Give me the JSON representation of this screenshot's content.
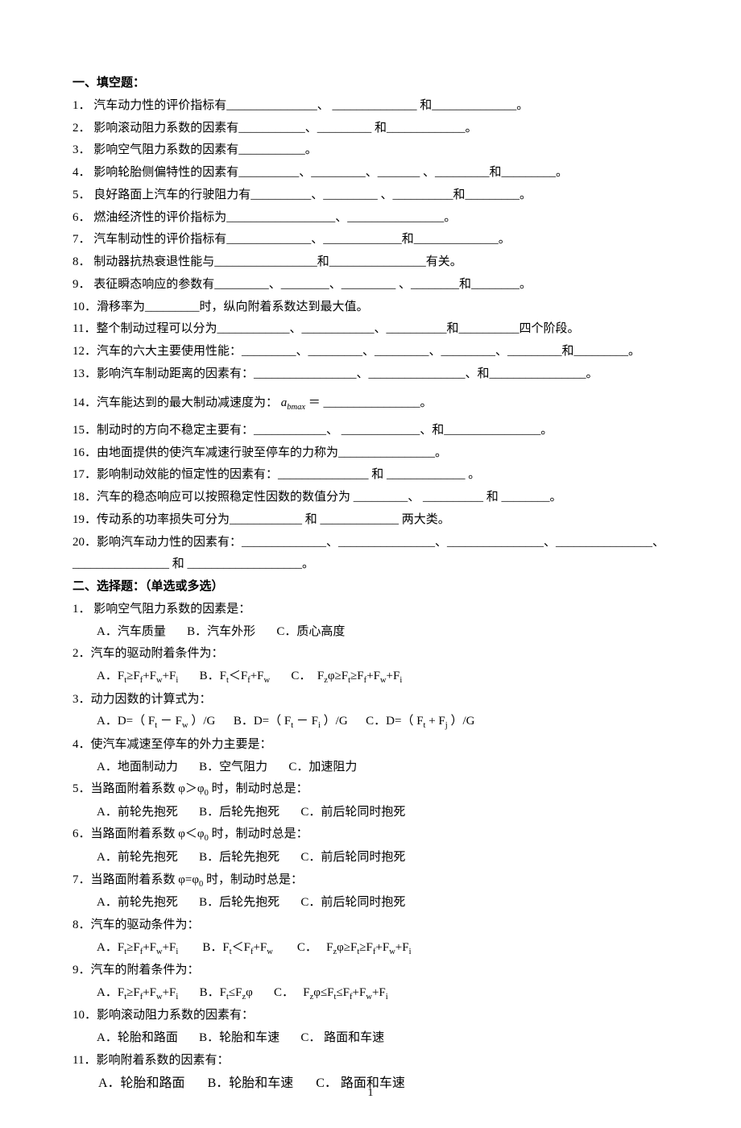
{
  "section1": {
    "title": "一、填空题：",
    "items": [
      "1．  汽车动力性的评价指标有_______________、 ______________ 和______________。",
      "2．  影响滚动阻力系数的因素有___________、_________  和_____________。",
      "3．  影响空气阻力系数的因素有___________。",
      "4．  影响轮胎侧偏特性的因素有__________、_________、_______ 、_________和_________。",
      "5．  良好路面上汽车的行驶阻力有__________、_________ 、__________和_________。",
      "6．  燃油经济性的评价指标为__________________、________________。",
      "7．  汽车制动性的评价指标有______________、_____________和______________。",
      "8．  制动器抗热衰退性能与_________________和________________有关。",
      "9．  表征瞬态响应的参数有_________、________、_________ 、________和________。",
      "10．滑移率为_________时，纵向附着系数达到最大值。",
      "11．整个制动过程可以分为____________、____________、__________和__________四个阶段。",
      "12．汽车的六大主要使用性能：_________、_________、_________、_________、_________和_________。",
      "13．影响汽车制动距离的因素有：_________________、________________、和________________。",
      "14．汽车能达到的最大制动减速度为：",
      "15．制动时的方向不稳定主要有：____________、 _____________、和________________。",
      "16．由地面提供的使汽车减速行驶至停车的力称为________________。",
      "17．影响制动效能的恒定性的因素有：_______________  和  _____________ 。",
      "18．汽车的稳态响应可以按照稳定性因数的数值分为 _________、 __________ 和 ________。",
      "19．传动系的功率损失可分为____________ 和 _____________ 两大类。",
      "20．影响汽车动力性的因素有：______________、________________、________________、________________、________________ 和 ___________________。"
    ],
    "formula14": "a",
    "formula14_sub": "bmax",
    "formula14_suffix": " ＝ ________________。"
  },
  "section2": {
    "title": "二、选择题：（单选或多选）",
    "q1": {
      "stem": "1．  影响空气阻力系数的因素是：",
      "opts": [
        "A．汽车质量",
        "B．汽车外形",
        "C．质心高度"
      ]
    },
    "q2": {
      "stem": "2．汽车的驱动附着条件为：",
      "opts": "A．F_t≥F_f+F_w+F_i        B．F_t＜F_f+F_w        C．  F_zφ≥F_t≥F_f+F_w+F_i"
    },
    "q3": {
      "stem": "3．动力因数的计算式为：",
      "opts": "A．D=（ F_t － F_w ）/G        B．D=（ F_t － F_i ）/G        C．D=（ F_t + F_j ）/G"
    },
    "q4": {
      "stem": "4．使汽车减速至停车的外力主要是：",
      "opts": [
        "A．地面制动力",
        "B．空气阻力",
        "C．加速阻力"
      ]
    },
    "q5": {
      "stem": "5．当路面附着系数 φ＞φ_0 时，制动时总是：",
      "opts": [
        "A．前轮先抱死",
        "B．后轮先抱死",
        "C．前后轮同时抱死"
      ]
    },
    "q6": {
      "stem": "6．当路面附着系数 φ＜φ_0 时，制动时总是：",
      "opts": [
        "A．前轮先抱死",
        "B．后轮先抱死",
        "C．前后轮同时抱死"
      ]
    },
    "q7": {
      "stem": "7．当路面附着系数 φ=φ_0 时，制动时总是：",
      "opts": [
        "A．前轮先抱死",
        "B．后轮先抱死",
        "C．前后轮同时抱死"
      ]
    },
    "q8": {
      "stem": "8．汽车的驱动条件为：",
      "opts": "A．F_t≥F_f+F_w+F_i         B．F_t＜F_f+F_w         C．   F_zφ≥F_t≥F_f+F_w+F_i"
    },
    "q9": {
      "stem": "9．汽车的附着条件为：",
      "opts": "A．F_t≥F_f+F_w+F_i        B．F_t≤F_zφ        C．   F_zφ≤F_t≤F_f+F_w+F_i"
    },
    "q10": {
      "stem": "10．影响滚动阻力系数的因素有：",
      "opts": [
        "A．轮胎和路面",
        "B．轮胎和车速",
        "C．  路面和车速"
      ]
    },
    "q11": {
      "stem": "11．影响附着系数的因素有：",
      "opts": [
        "A．轮胎和路面",
        "B．轮胎和车速",
        "C．  路面和车速"
      ]
    }
  },
  "page_num": "1"
}
